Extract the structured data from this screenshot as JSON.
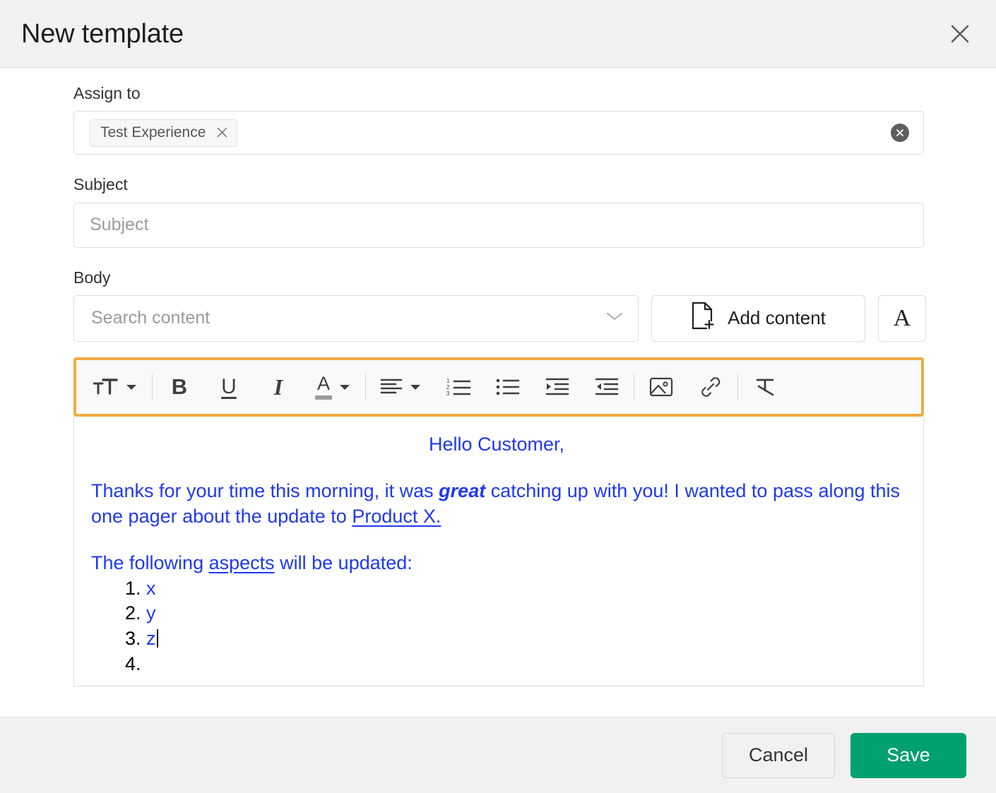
{
  "header": {
    "title": "New template",
    "close_icon": "close-icon"
  },
  "form": {
    "assign_to": {
      "label": "Assign to",
      "chips": [
        {
          "label": "Test Experience",
          "remove_icon": "close-icon"
        }
      ],
      "clear_icon": "clear-circle-icon"
    },
    "subject": {
      "label": "Subject",
      "placeholder": "Subject",
      "value": ""
    },
    "body": {
      "label": "Body",
      "search": {
        "placeholder": "Search content",
        "value": "",
        "dropdown_icon": "chevron-down-icon"
      },
      "add_content": {
        "label": "Add content",
        "icon": "document-add-icon"
      },
      "font_button": {
        "label": "A",
        "icon": "font-family-icon"
      }
    }
  },
  "toolbar": {
    "highlight_color": "#efab43",
    "items": [
      {
        "name": "font-size-button",
        "icon": "font-size-icon",
        "has_caret": true
      },
      {
        "name": "bold-button",
        "icon": "bold-icon",
        "glyph": "B"
      },
      {
        "name": "underline-button",
        "icon": "underline-icon",
        "glyph": "U"
      },
      {
        "name": "italic-button",
        "icon": "italic-icon",
        "glyph": "I"
      },
      {
        "name": "text-color-button",
        "icon": "text-color-icon",
        "glyph": "A",
        "has_caret": true
      },
      {
        "name": "align-button",
        "icon": "align-left-icon",
        "has_caret": true
      },
      {
        "name": "ordered-list-button",
        "icon": "numbered-list-icon"
      },
      {
        "name": "bullet-list-button",
        "icon": "bullet-list-icon"
      },
      {
        "name": "indent-button",
        "icon": "indent-increase-icon"
      },
      {
        "name": "outdent-button",
        "icon": "indent-decrease-icon"
      },
      {
        "name": "insert-image-button",
        "icon": "image-icon"
      },
      {
        "name": "insert-link-button",
        "icon": "link-icon"
      },
      {
        "name": "clear-formatting-button",
        "icon": "clear-formatting-icon"
      }
    ]
  },
  "editor": {
    "text_color": "#1f39ef",
    "greeting": "Hello Customer,",
    "paragraph": {
      "before_bold": "Thanks for your time this morning, it was ",
      "bold_italic": "great",
      "after_bold": " catching up with you! I wanted to pass along this one pager about the update to ",
      "link": "Product X."
    },
    "intro": {
      "before_link": "The following ",
      "link": "aspects",
      "after_link": " will be updated:"
    },
    "list_items": [
      "x",
      "y",
      "z",
      ""
    ],
    "cursor_after_item": 3
  },
  "footer": {
    "cancel_label": "Cancel",
    "save_label": "Save",
    "save_color": "#00a070"
  }
}
